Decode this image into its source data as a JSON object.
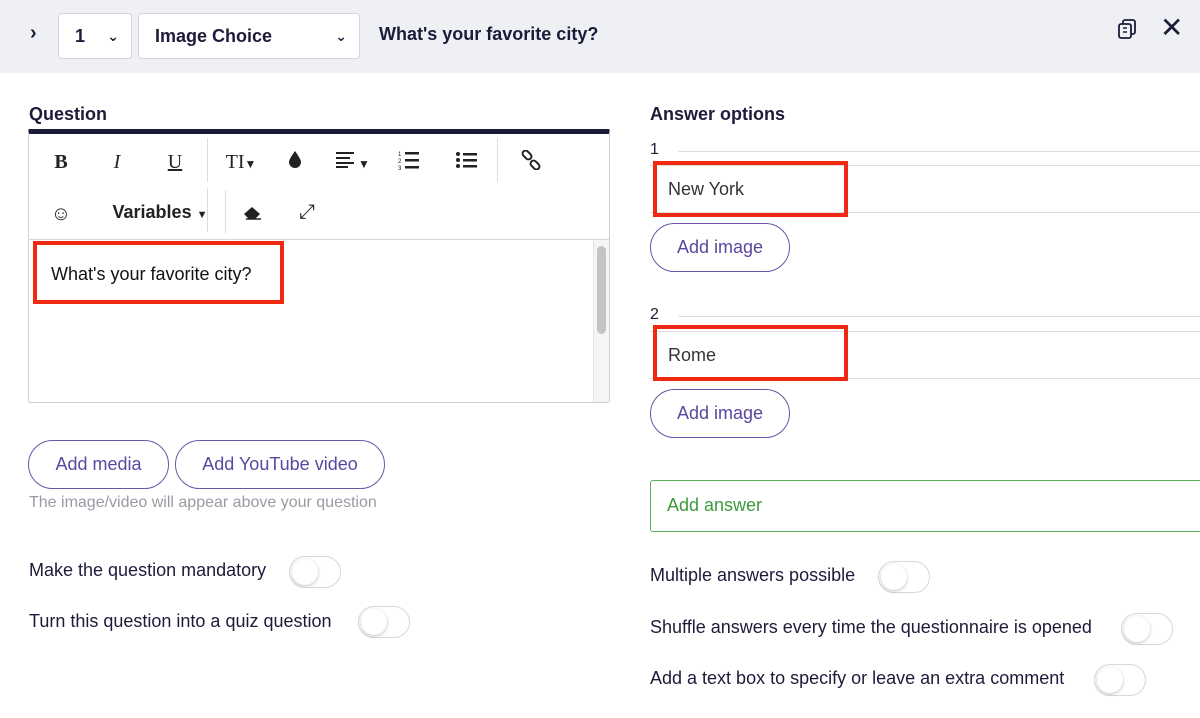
{
  "header": {
    "expand_icon": "chevron-right-icon",
    "number_select": {
      "value": "1"
    },
    "type_select": {
      "value": "Image Choice"
    },
    "title": "What's your favorite city?",
    "copy_icon": "duplicate-icon",
    "close_icon": "close-icon"
  },
  "question": {
    "label": "Question",
    "toolbar": {
      "bold": "B",
      "italic": "I",
      "underline": "U",
      "text_size": "TI",
      "variables": "Variables"
    },
    "text": "What's your favorite city?",
    "add_media": "Add media",
    "add_youtube": "Add YouTube video",
    "hint": "The image/video will appear above your question",
    "mandatory_label": "Make the question mandatory",
    "quiz_label": "Turn this question into a quiz question"
  },
  "answers": {
    "label": "Answer options",
    "options": [
      {
        "number": "1",
        "value": "New York",
        "add_image": "Add image"
      },
      {
        "number": "2",
        "value": "Rome",
        "add_image": "Add image"
      }
    ],
    "add_answer": "Add answer",
    "multiple_label": "Multiple answers possible",
    "shuffle_label": "Shuffle answers every time the questionnaire is opened",
    "textbox_label": "Add a text box to specify or leave an extra comment"
  },
  "colors": {
    "accent": "#6a55a8",
    "highlight": "#ee2a12",
    "add_answer": "#5cae5a",
    "header_bg": "#eef0f4"
  }
}
